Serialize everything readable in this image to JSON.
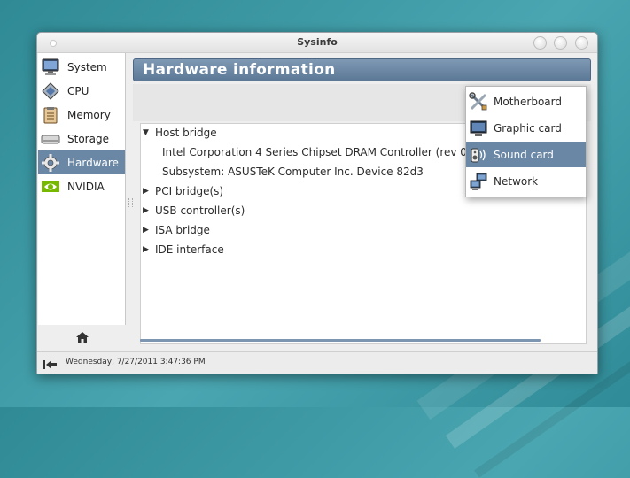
{
  "window": {
    "title": "Sysinfo"
  },
  "sidebar": {
    "items": [
      {
        "label": "System",
        "icon": "monitor-icon"
      },
      {
        "label": "CPU",
        "icon": "cpu-icon"
      },
      {
        "label": "Memory",
        "icon": "memory-icon"
      },
      {
        "label": "Storage",
        "icon": "storage-icon"
      },
      {
        "label": "Hardware",
        "icon": "gear-icon",
        "active": true
      },
      {
        "label": "NVIDIA",
        "icon": "nvidia-icon"
      }
    ],
    "home_icon": "home-icon"
  },
  "header": {
    "title": "Hardware information"
  },
  "tree": {
    "items": [
      {
        "label": "Host bridge",
        "expanded": true,
        "children": [
          "Intel Corporation 4 Series Chipset DRAM Controller (rev 03)",
          "Subsystem: ASUSTeK Computer Inc. Device 82d3"
        ]
      },
      {
        "label": "PCI bridge(s)",
        "expanded": false
      },
      {
        "label": "USB controller(s)",
        "expanded": false
      },
      {
        "label": "ISA bridge",
        "expanded": false
      },
      {
        "label": "IDE interface",
        "expanded": false
      }
    ]
  },
  "popup_menu": {
    "items": [
      {
        "label": "Motherboard",
        "icon": "tools-icon"
      },
      {
        "label": "Graphic card",
        "icon": "display-icon"
      },
      {
        "label": "Sound card",
        "icon": "speaker-icon",
        "selected": true
      },
      {
        "label": "Network",
        "icon": "network-icon"
      }
    ]
  },
  "statusbar": {
    "text": "Wednesday, 7/27/2011 3:47:36 PM"
  },
  "colors": {
    "accent": "#6a88a6",
    "header_bg": "#6d89a6",
    "desktop": "#3f9ba6"
  }
}
